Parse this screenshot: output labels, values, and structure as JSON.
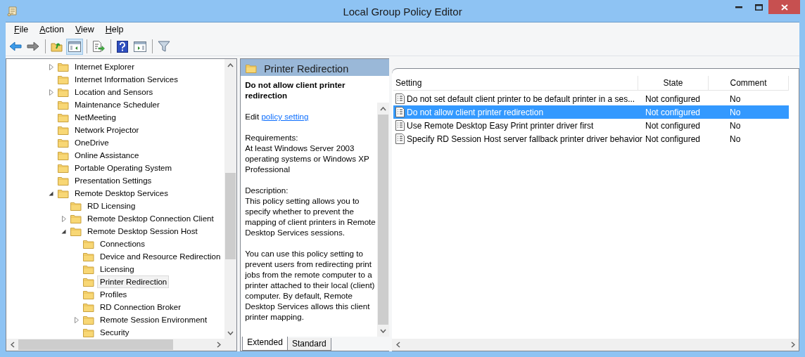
{
  "window": {
    "title": "Local Group Policy Editor"
  },
  "menu": [
    {
      "label": "File"
    },
    {
      "label": "Action"
    },
    {
      "label": "View"
    },
    {
      "label": "Help"
    }
  ],
  "toolbar_groups": [
    [
      {
        "selected": false
      },
      {
        "selected": false
      }
    ],
    [
      {
        "selected": false
      },
      {
        "selected": true
      }
    ],
    [
      {
        "selected": false
      }
    ],
    [
      {
        "selected": false
      },
      {
        "selected": false
      }
    ],
    [
      {
        "selected": false
      }
    ]
  ],
  "tree": [
    {
      "label": "Internet Explorer",
      "expanded": false,
      "selected": false
    },
    {
      "label": "Internet Information Services",
      "selected": false
    },
    {
      "label": "Location and Sensors",
      "expanded": false,
      "selected": false
    },
    {
      "label": "Maintenance Scheduler",
      "selected": false
    },
    {
      "label": "NetMeeting",
      "selected": false
    },
    {
      "label": "Network Projector",
      "selected": false
    },
    {
      "label": "OneDrive",
      "selected": false
    },
    {
      "label": "Online Assistance",
      "selected": false
    },
    {
      "label": "Portable Operating System",
      "selected": false
    },
    {
      "label": "Presentation Settings",
      "selected": false
    },
    {
      "label": "Remote Desktop Services",
      "expanded": true,
      "selected": false,
      "children": [
        {
          "label": "RD Licensing",
          "selected": false
        },
        {
          "label": "Remote Desktop Connection Client",
          "expanded": false,
          "selected": false
        },
        {
          "label": "Remote Desktop Session Host",
          "expanded": true,
          "selected": false,
          "children": [
            {
              "label": "Connections",
              "selected": false
            },
            {
              "label": "Device and Resource Redirection",
              "selected": false
            },
            {
              "label": "Licensing",
              "selected": false
            },
            {
              "label": "Printer Redirection",
              "selected": true
            },
            {
              "label": "Profiles",
              "selected": false
            },
            {
              "label": "RD Connection Broker",
              "selected": false
            },
            {
              "label": "Remote Session Environment",
              "expanded": false,
              "selected": false
            },
            {
              "label": "Security",
              "selected": false
            }
          ]
        }
      ]
    }
  ],
  "details": {
    "header": "Printer Redirection",
    "title": "Do not allow client printer redirection",
    "edit_prefix": "Edit",
    "edit_link": "policy setting",
    "requirements_label": "Requirements:",
    "requirements": "At least Windows Server 2003 operating systems or Windows XP Professional",
    "description_label": "Description:",
    "description": "This policy setting allows you to specify whether to prevent the mapping of client printers in Remote Desktop Services sessions.",
    "description_more": "You can use this policy setting to prevent users from redirecting print jobs from the remote computer to a printer attached to their local (client) computer. By default, Remote Desktop Services allows this client printer mapping."
  },
  "tabs": [
    {
      "label": "Extended",
      "selected": true
    },
    {
      "label": "Standard",
      "selected": false
    }
  ],
  "table": {
    "columns": [
      "Setting",
      "State",
      "Comment"
    ],
    "rows": [
      {
        "setting": "Do not set default client printer to be default printer in a ses...",
        "state": "Not configured",
        "comment": "No",
        "selected": false
      },
      {
        "setting": "Do not allow client printer redirection",
        "state": "Not configured",
        "comment": "No",
        "selected": true
      },
      {
        "setting": "Use Remote Desktop Easy Print printer driver first",
        "state": "Not configured",
        "comment": "No",
        "selected": false
      },
      {
        "setting": "Specify RD Session Host server fallback printer driver behavior",
        "state": "Not configured",
        "comment": "No",
        "selected": false
      }
    ]
  }
}
